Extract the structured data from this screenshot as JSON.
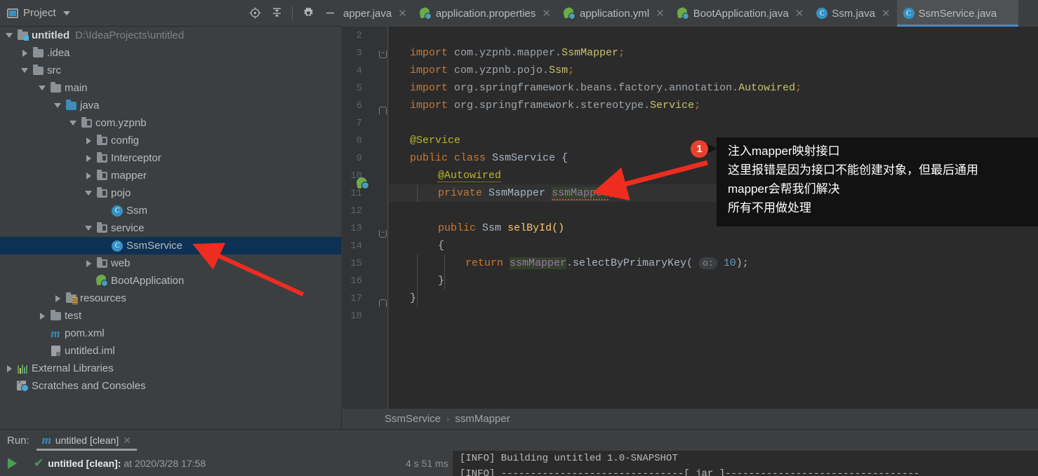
{
  "project_panel": {
    "title": "Project",
    "icons": [
      "locate-target-icon",
      "collapse-all-icon",
      "settings-gear-icon",
      "minimize-icon"
    ],
    "tree": [
      {
        "label": "untitled",
        "path": "D:\\IdeaProjects\\untitled",
        "icon": "module-folder-icon",
        "arrow": "down",
        "depth": 0,
        "bold": true
      },
      {
        "label": ".idea",
        "path": "",
        "icon": "folder-icon",
        "arrow": "right",
        "depth": 1,
        "bold": false
      },
      {
        "label": "src",
        "path": "",
        "icon": "folder-icon",
        "arrow": "down",
        "depth": 1,
        "bold": false
      },
      {
        "label": "main",
        "path": "",
        "icon": "folder-icon",
        "arrow": "down",
        "depth": 2,
        "bold": false
      },
      {
        "label": "java",
        "path": "",
        "icon": "source-folder-icon",
        "arrow": "down",
        "depth": 3,
        "bold": false
      },
      {
        "label": "com.yzpnb",
        "path": "",
        "icon": "package-icon",
        "arrow": "down",
        "depth": 4,
        "bold": false
      },
      {
        "label": "config",
        "path": "",
        "icon": "package-icon",
        "arrow": "right",
        "depth": 5,
        "bold": false
      },
      {
        "label": "Interceptor",
        "path": "",
        "icon": "package-icon",
        "arrow": "right",
        "depth": 5,
        "bold": false
      },
      {
        "label": "mapper",
        "path": "",
        "icon": "package-icon",
        "arrow": "right",
        "depth": 5,
        "bold": false
      },
      {
        "label": "pojo",
        "path": "",
        "icon": "package-icon",
        "arrow": "down",
        "depth": 5,
        "bold": false
      },
      {
        "label": "Ssm",
        "path": "",
        "icon": "java-class-icon",
        "arrow": "none",
        "depth": 6,
        "bold": false
      },
      {
        "label": "service",
        "path": "",
        "icon": "package-icon",
        "arrow": "down",
        "depth": 5,
        "bold": false
      },
      {
        "label": "SsmService",
        "path": "",
        "icon": "java-class-icon",
        "arrow": "none",
        "depth": 6,
        "bold": false,
        "selected": true
      },
      {
        "label": "web",
        "path": "",
        "icon": "package-icon",
        "arrow": "right",
        "depth": 5,
        "bold": false
      },
      {
        "label": "BootApplication",
        "path": "",
        "icon": "spring-boot-icon",
        "arrow": "none",
        "depth": 5,
        "bold": false
      },
      {
        "label": "resources",
        "path": "",
        "icon": "resources-folder-icon",
        "arrow": "right",
        "depth": 3,
        "bold": false
      },
      {
        "label": "test",
        "path": "",
        "icon": "folder-icon",
        "arrow": "right",
        "depth": 2,
        "bold": false
      },
      {
        "label": "pom.xml",
        "path": "",
        "icon": "maven-icon",
        "arrow": "none",
        "depth": 1,
        "bold": false
      },
      {
        "label": "untitled.iml",
        "path": "",
        "icon": "iml-file-icon",
        "arrow": "none",
        "depth": 1,
        "bold": false
      },
      {
        "label": "External Libraries",
        "path": "",
        "icon": "library-icon",
        "arrow": "right",
        "depth": 0,
        "bold": false
      },
      {
        "label": "Scratches and Consoles",
        "path": "",
        "icon": "scratches-icon",
        "arrow": "none",
        "depth": 0,
        "bold": false
      }
    ]
  },
  "tabs": [
    {
      "label": "apper.java",
      "icon": "none",
      "active": false,
      "truncated": true
    },
    {
      "label": "application.properties",
      "icon": "spring-boot-icon",
      "active": false
    },
    {
      "label": "application.yml",
      "icon": "spring-boot-icon",
      "active": false
    },
    {
      "label": "BootApplication.java",
      "icon": "spring-boot-icon",
      "active": false
    },
    {
      "label": "Ssm.java",
      "icon": "java-class-icon",
      "active": false
    },
    {
      "label": "SsmService.java",
      "icon": "java-class-icon",
      "active": true
    }
  ],
  "editor": {
    "line_numbers": [
      "2",
      "3",
      "4",
      "5",
      "6",
      "7",
      "8",
      "9",
      "10",
      "11",
      "12",
      "13",
      "14",
      "15",
      "16",
      "17",
      "18"
    ],
    "current_line": "11",
    "caret_line": "11",
    "lines": {
      "l3": {
        "kw": "import",
        "rest": "com.yzpnb.mapper.",
        "cls": "SsmMapper",
        "semi": ";"
      },
      "l4": {
        "kw": "import",
        "rest": "com.yzpnb.pojo.",
        "cls": "Ssm",
        "semi": ";"
      },
      "l5": {
        "kw": "import",
        "rest": "org.springframework.beans.factory.annotation.",
        "cls": "Autowired",
        "semi": ";"
      },
      "l6": {
        "kw": "import",
        "rest": "org.springframework.stereotype.",
        "cls": "Service",
        "semi": ";"
      },
      "l8": {
        "annotation": "@Service"
      },
      "l9": {
        "kw1": "public",
        "kw2": "class",
        "name": "SsmService",
        "brace": "{"
      },
      "l10": {
        "annotation": "@Autowired"
      },
      "l11": {
        "kw": "private",
        "type": "SsmMapper",
        "field": "ssmMapper",
        "semi": ";"
      },
      "l13": {
        "kw1": "public",
        "type": "Ssm",
        "method": "selById()"
      },
      "l14": {
        "brace": "{"
      },
      "l15": {
        "kw": "return",
        "field": "ssmMapper",
        "call": ".selectByPrimaryKey(",
        "hint": "o:",
        "num": "10",
        "tail": ");"
      },
      "l16": {
        "brace": "}"
      },
      "l17": {
        "brace": "}"
      }
    },
    "breadcrumb": [
      "SsmService",
      "ssmMapper"
    ]
  },
  "callout": {
    "badge": "1",
    "lines": [
      "注入mapper映射接口",
      "这里报错是因为接口不能创建对象，但最后通用",
      "mapper会帮我们解决",
      "所有不用做处理"
    ]
  },
  "run_panel": {
    "label": "Run:",
    "tab_name": "untitled [clean]",
    "tab_icon": "maven-icon",
    "close_icon": "close-icon",
    "play_icon": "run-play-icon",
    "status_check": "✔",
    "status_name": "untitled [clean]:",
    "status_at": "at 2020/3/28 17:58",
    "elapsed": "4 s 51 ms",
    "console": [
      "[INFO] Building untitled 1.0-SNAPSHOT",
      "[INFO] -------------------------------[ jar ]---------------------------------"
    ]
  },
  "colors": {
    "panel_bg": "#3c3f41",
    "editor_bg": "#2b2b2b",
    "gutter_bg": "#313335",
    "selection": "#0d3055",
    "accent_tab": "#4a88c7",
    "keyword": "#cc7832",
    "annotation": "#bbb529",
    "number": "#6897bb",
    "field": "#9876aa",
    "badge_red": "#e8412b",
    "arrow_red": "#ee2c20",
    "green": "#499c54"
  }
}
